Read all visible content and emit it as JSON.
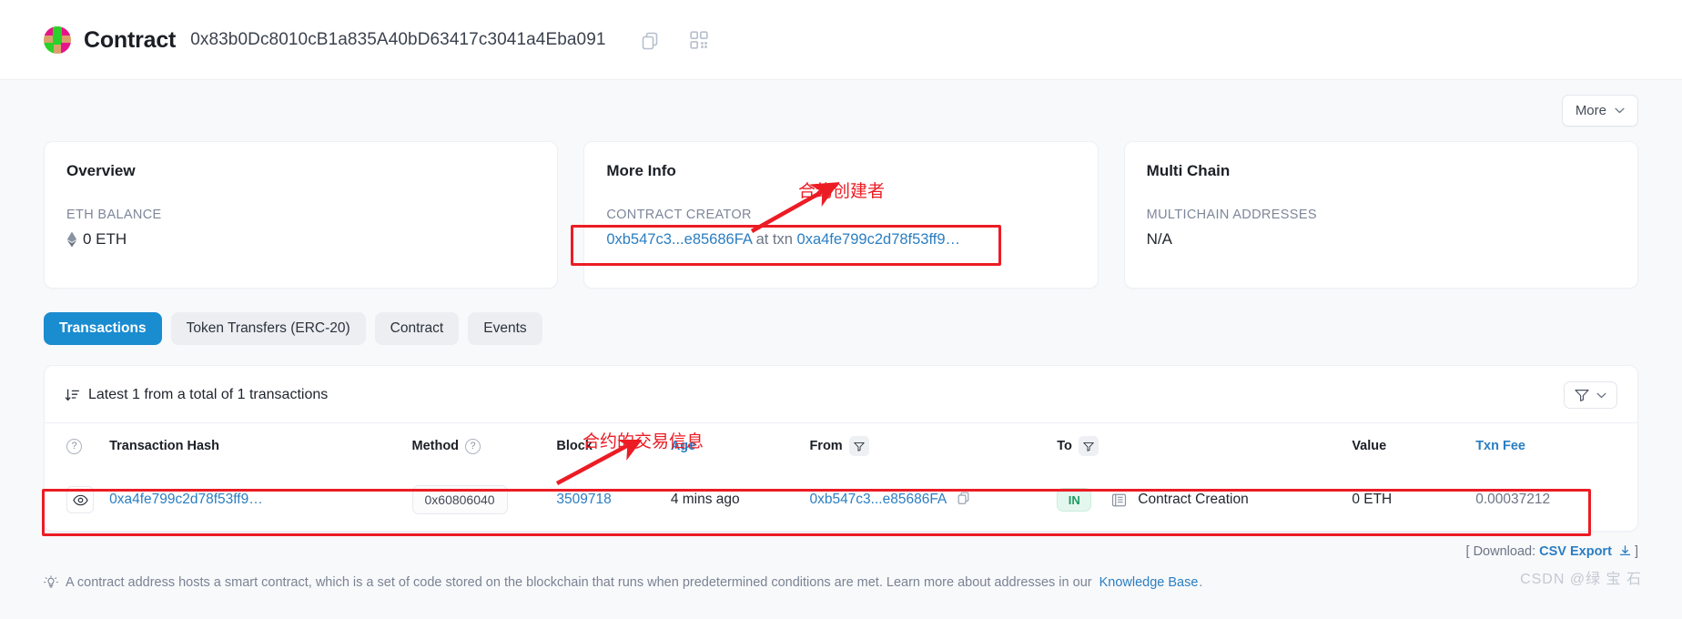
{
  "header": {
    "title": "Contract",
    "address": "0x83b0Dc8010cB1a835A40bD63417c3041a4Eba091",
    "copy_icon": "copy-icon",
    "qr_icon": "qr-code-icon"
  },
  "toolbar": {
    "more_label": "More"
  },
  "cards": {
    "overview": {
      "title": "Overview",
      "label": "ETH BALANCE",
      "value": "0 ETH"
    },
    "more_info": {
      "title": "More Info",
      "label": "CONTRACT CREATOR",
      "creator_address": "0xb547c3...e85686FA",
      "at_txn": "at txn",
      "creation_txn": "0xa4fe799c2d78f53ff9…"
    },
    "multi_chain": {
      "title": "Multi Chain",
      "label": "MULTICHAIN ADDRESSES",
      "value": "N/A"
    }
  },
  "tabs": [
    {
      "label": "Transactions",
      "active": true
    },
    {
      "label": "Token Transfers (ERC-20)",
      "active": false
    },
    {
      "label": "Contract",
      "active": false
    },
    {
      "label": "Events",
      "active": false
    }
  ],
  "table_panel": {
    "summary": "Latest 1 from a total of 1 transactions",
    "sort_icon": "sort-descending-icon",
    "filter_icon": "funnel-icon",
    "filter_chevron_icon": "chevron-down-icon",
    "columns": [
      "Transaction Hash",
      "Method",
      "Block",
      "Age",
      "From",
      "To",
      "Value",
      "Txn Fee"
    ],
    "rows": [
      {
        "eye_icon": "eye-icon",
        "hash": "0xa4fe799c2d78f53ff9…",
        "method": "0x60806040",
        "block": "3509718",
        "age": "4 mins ago",
        "from": "0xb547c3...e85686FA",
        "from_copy_icon": "copy-icon",
        "direction": "IN",
        "to_icon": "contract-icon",
        "to": "Contract Creation",
        "value": "0 ETH",
        "txn_fee": "0.00037212"
      }
    ],
    "download_prefix": "[ Download:",
    "download_link": "CSV Export",
    "download_suffix": "]",
    "download_icon": "download-icon"
  },
  "footnote": {
    "icon": "lightbulb-icon",
    "text": "A contract address hosts a smart contract, which is a set of code stored on the blockchain that runs when predetermined conditions are met. Learn more about addresses in our",
    "link": "Knowledge Base",
    "period": "."
  },
  "annotations": {
    "creator_note": "合约创建者",
    "tx_note": "合约的交易信息",
    "accent": "#ec1c24"
  },
  "watermark": "CSDN @绿 宝 石"
}
